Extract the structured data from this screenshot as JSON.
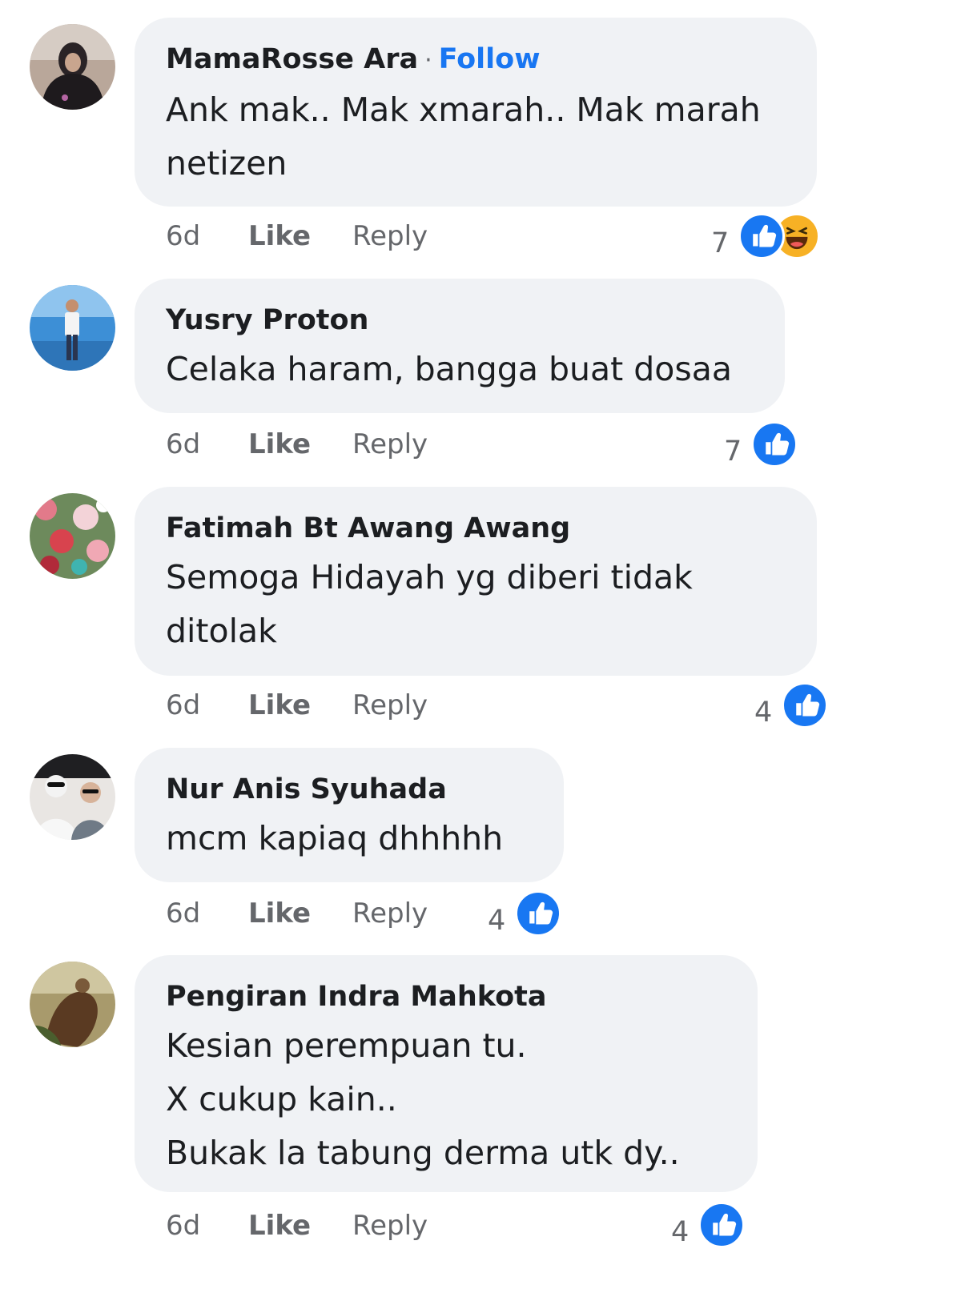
{
  "comments": [
    {
      "author": "MamaRosse Ara",
      "follow_label": "Follow",
      "text_lines": [
        "Ank mak.. Mak xmarah.. Mak marah",
        "netizen"
      ],
      "time": "6d",
      "like_label": "Like",
      "reply_label": "Reply",
      "reaction_count": "7",
      "reactions": [
        "like-icon",
        "haha-icon"
      ]
    },
    {
      "author": "Yusry Proton",
      "text_lines": [
        "Celaka haram, bangga buat dosaa"
      ],
      "time": "6d",
      "like_label": "Like",
      "reply_label": "Reply",
      "reaction_count": "7",
      "reactions": [
        "like-icon"
      ]
    },
    {
      "author": "Fatimah Bt Awang Awang",
      "text_lines": [
        "Semoga Hidayah yg diberi tidak",
        "ditolak"
      ],
      "time": "6d",
      "like_label": "Like",
      "reply_label": "Reply",
      "reaction_count": "4",
      "reactions": [
        "like-icon"
      ]
    },
    {
      "author": "Nur Anis Syuhada",
      "text_lines": [
        "mcm kapiaq dhhhhh"
      ],
      "time": "6d",
      "like_label": "Like",
      "reply_label": "Reply",
      "reaction_count": "4",
      "reactions": [
        "like-icon"
      ]
    },
    {
      "author": "Pengiran Indra Mahkota",
      "text_lines": [
        "Kesian perempuan tu.",
        "X cukup kain..",
        "Bukak la tabung derma utk dy.."
      ],
      "time": "6d",
      "like_label": "Like",
      "reply_label": "Reply",
      "reaction_count": "4",
      "reactions": [
        "like-icon"
      ]
    }
  ],
  "colors": {
    "bubble_bg": "#f0f2f5",
    "link_blue": "#1876f2",
    "like_blue": "#1877f2",
    "muted_text": "#65676b"
  }
}
